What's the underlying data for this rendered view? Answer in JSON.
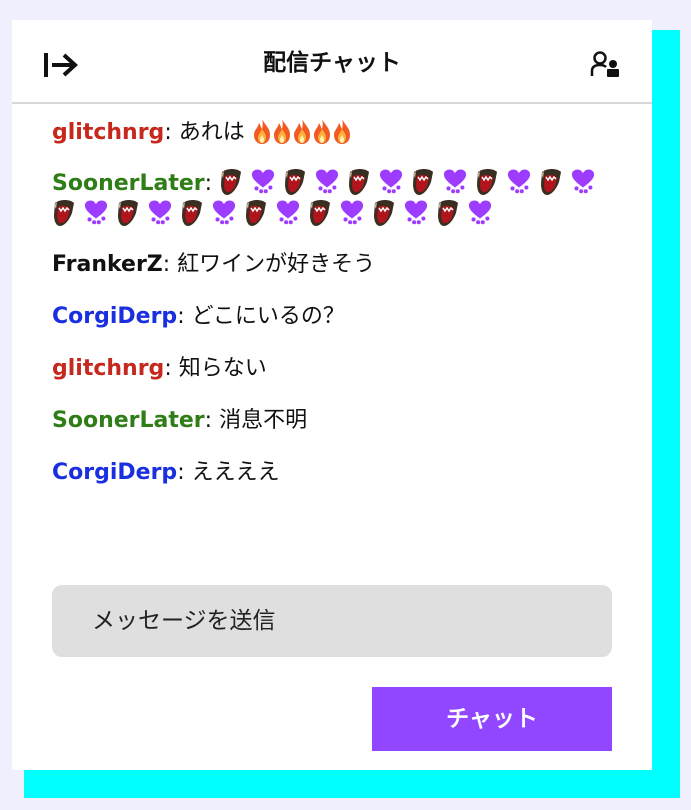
{
  "header": {
    "title": "配信チャット"
  },
  "icons": {
    "collapse": "arrow-to-right-icon",
    "users": "community-users-icon",
    "fire": "fire-emote",
    "heart": "purple-dripping-heart-emote",
    "mouth": "screaming-mouth-emote"
  },
  "colors": {
    "accent": "#9147ff",
    "red_user": "#c7281d",
    "green_user": "#2e7d16",
    "black_user": "#111111",
    "blue_user": "#1a2fe0",
    "cyan_shadow": "#00ffff"
  },
  "messages": [
    {
      "user": "glitchnrg",
      "sep": ": ",
      "text": "あれは",
      "color": "#c7281d"
    },
    {
      "user": "SoonerLater",
      "sep": ": ",
      "text": "",
      "color": "#2e7d16"
    },
    {
      "user": "FrankerZ",
      "sep": ": ",
      "text": "紅ワインが好きそう",
      "color": "#111111"
    },
    {
      "user": "CorgiDerp",
      "sep": ": ",
      "text": "どこにいるの？",
      "color": "#1a2fe0"
    },
    {
      "user": "glitchnrg",
      "sep": ": ",
      "text": "知らない",
      "color": "#c7281d"
    },
    {
      "user": "SoonerLater",
      "sep": ": ",
      "text": "消息不明",
      "color": "#2e7d16"
    },
    {
      "user": "CorgiDerp",
      "sep": ": ",
      "text": "ええええ",
      "color": "#1a2fe0"
    }
  ],
  "input": {
    "placeholder": "メッセージを送信"
  },
  "send_button": {
    "label": "チャット"
  }
}
